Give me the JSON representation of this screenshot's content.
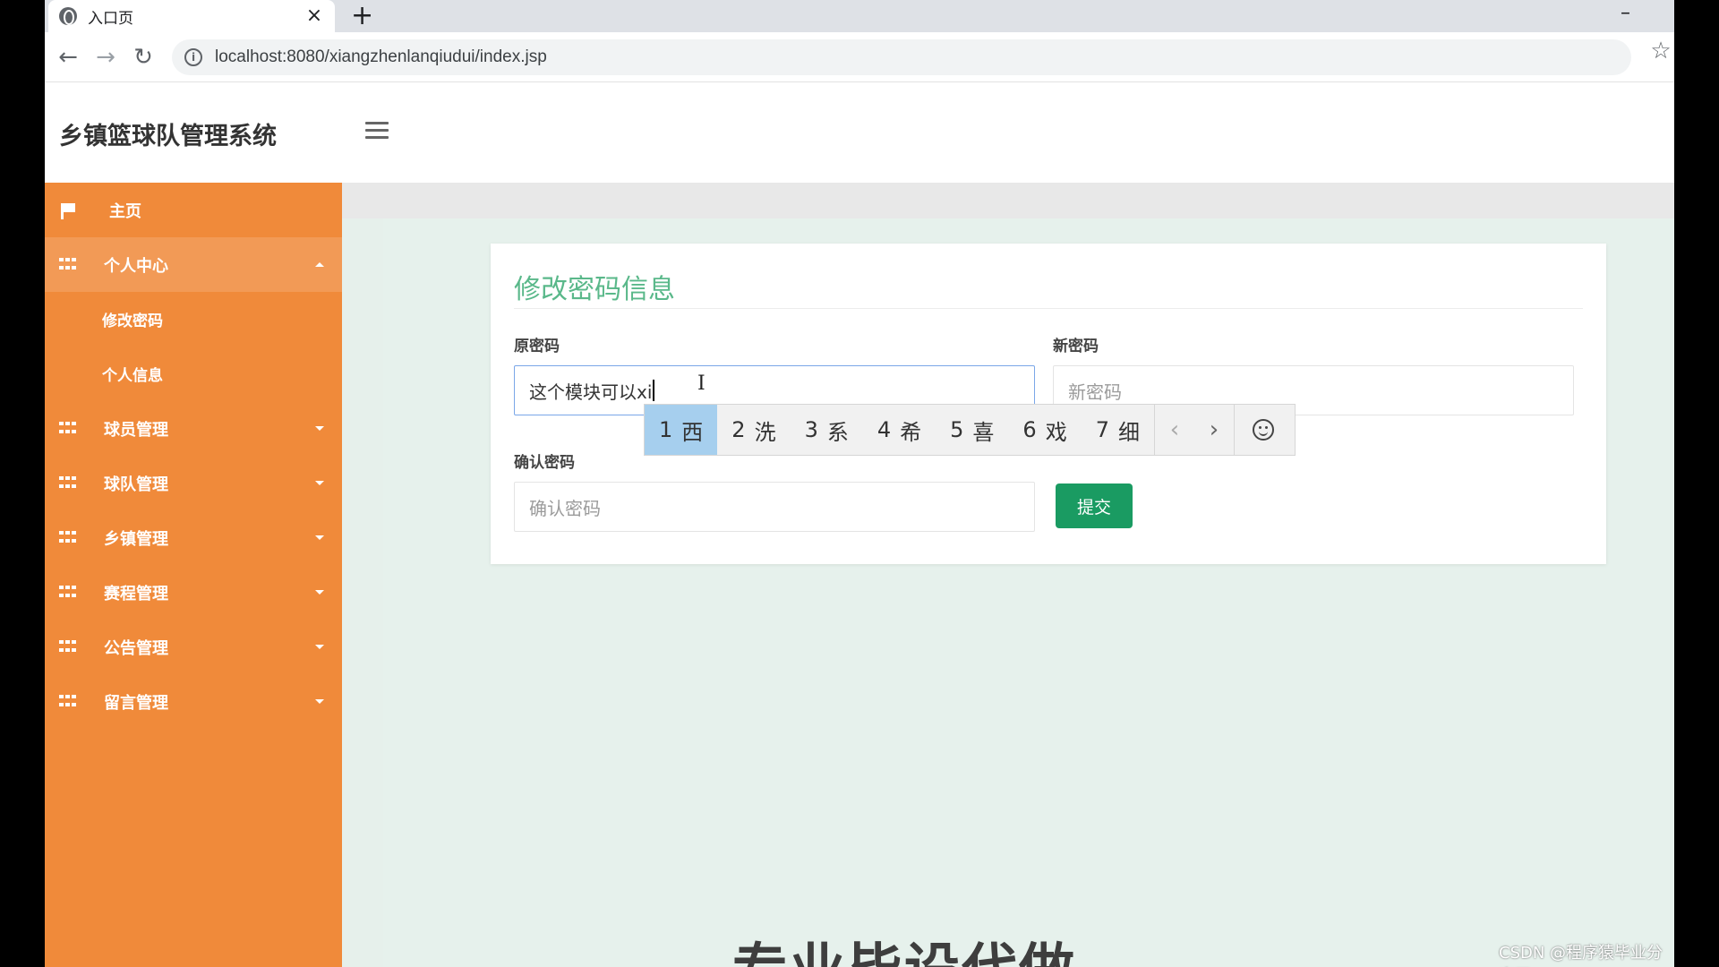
{
  "browser": {
    "tab_title": "入口页",
    "tab_close": "×",
    "new_tab": "+",
    "minimize": "–",
    "url": "localhost:8080/xiangzhenlanqiudui/index.jsp",
    "info_glyph": "i",
    "back_glyph": "←",
    "forward_glyph": "→",
    "reload_glyph": "↻",
    "star_glyph": "☆"
  },
  "app": {
    "title": "乡镇篮球队管理系统"
  },
  "sidebar": {
    "items": [
      {
        "label": "主页"
      },
      {
        "label": "个人中心"
      },
      {
        "label": "球员管理"
      },
      {
        "label": "球队管理"
      },
      {
        "label": "乡镇管理"
      },
      {
        "label": "赛程管理"
      },
      {
        "label": "公告管理"
      },
      {
        "label": "留言管理"
      }
    ],
    "subitems": [
      {
        "label": "修改密码"
      },
      {
        "label": "个人信息"
      }
    ]
  },
  "form": {
    "title": "修改密码信息",
    "old_password_label": "原密码",
    "old_password_value": "这个模块可以xi",
    "new_password_label": "新密码",
    "new_password_placeholder": "新密码",
    "confirm_label": "确认密码",
    "confirm_placeholder": "确认密码",
    "submit_label": "提交"
  },
  "ime": {
    "candidates": [
      {
        "num": "1",
        "char": "西"
      },
      {
        "num": "2",
        "char": "洗"
      },
      {
        "num": "3",
        "char": "系"
      },
      {
        "num": "4",
        "char": "希"
      },
      {
        "num": "5",
        "char": "喜"
      },
      {
        "num": "6",
        "char": "戏"
      },
      {
        "num": "7",
        "char": "细"
      }
    ],
    "prev": "‹",
    "next": "›"
  },
  "overlay": {
    "bottom_text": "专业毕设代做",
    "csdn": "CSDN @程序猿毕业分享网"
  }
}
